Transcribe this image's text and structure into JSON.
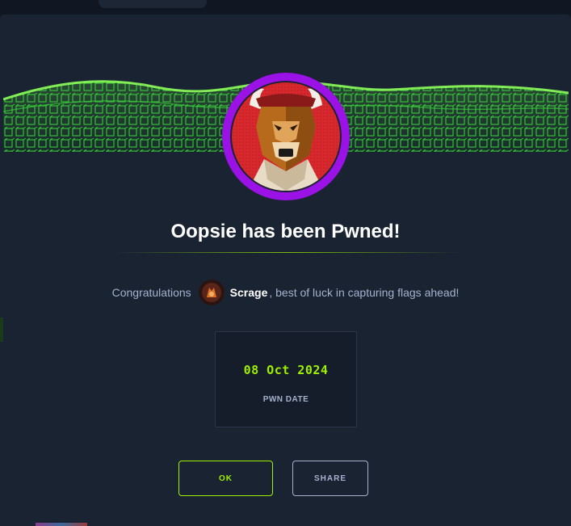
{
  "modal": {
    "title": "Oopsie has been Pwned!",
    "congrats_prefix": "Congratulations",
    "username": "Scrage",
    "congrats_suffix": ", best of luck in capturing flags ahead!",
    "pwn_date": "08 Oct 2024",
    "pwn_date_label": "PWN DATE",
    "ok_label": "OK",
    "share_label": "SHARE"
  },
  "icons": {
    "machine_avatar": "bull-avatar-icon",
    "user_avatar": "user-avatar-icon"
  },
  "colors": {
    "background": "#1a2332",
    "accent_green": "#9fef00",
    "ring_purple": "#9b12e6",
    "muted_text": "#a4b1cd"
  }
}
